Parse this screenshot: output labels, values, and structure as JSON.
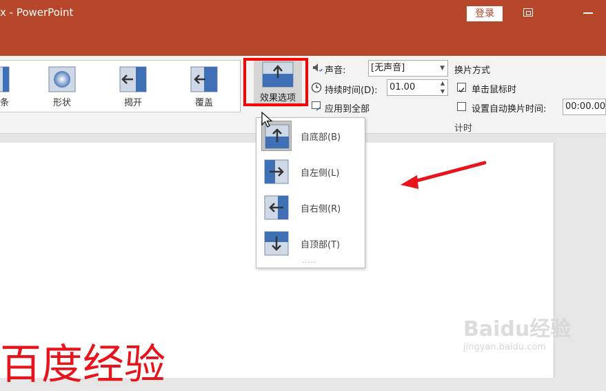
{
  "window": {
    "title": "x - PowerPoint",
    "signin_label": "登录",
    "colors": {
      "titlebar": "#b7472a",
      "accent_red": "#ff0000"
    }
  },
  "ribbon": {
    "gallery": [
      {
        "label": "条",
        "icon": "wipe-icon"
      },
      {
        "label": "形状",
        "icon": "shape-icon"
      },
      {
        "label": "揭开",
        "icon": "uncover-icon"
      },
      {
        "label": "覆盖",
        "icon": "cover-icon"
      }
    ],
    "effect_options_label": "效果选项",
    "timing": {
      "sound_label": "声音:",
      "sound_value": "[无声音]",
      "duration_label": "持续时间(D):",
      "duration_value": "01.00",
      "apply_all_label": "应用到全部",
      "advance_title": "换片方式",
      "on_click_label": "单击鼠标时",
      "on_click_checked": true,
      "after_label": "设置自动换片时间:",
      "after_value": "00:00.00",
      "after_checked": false,
      "group_label": "计时"
    }
  },
  "dropdown": {
    "items": [
      {
        "label": "自底部(B)",
        "icon": "from-bottom-icon",
        "selected": true
      },
      {
        "label": "自左侧(L)",
        "icon": "from-left-icon",
        "selected": false
      },
      {
        "label": "自右侧(R)",
        "icon": "from-right-icon",
        "selected": false
      },
      {
        "label": "自顶部(T)",
        "icon": "from-top-icon",
        "selected": false
      }
    ],
    "more": "....."
  },
  "slide": {
    "text": "百度经验"
  },
  "watermark": {
    "brand": "Baidu经验",
    "url": "jingyan.baidu.com"
  }
}
